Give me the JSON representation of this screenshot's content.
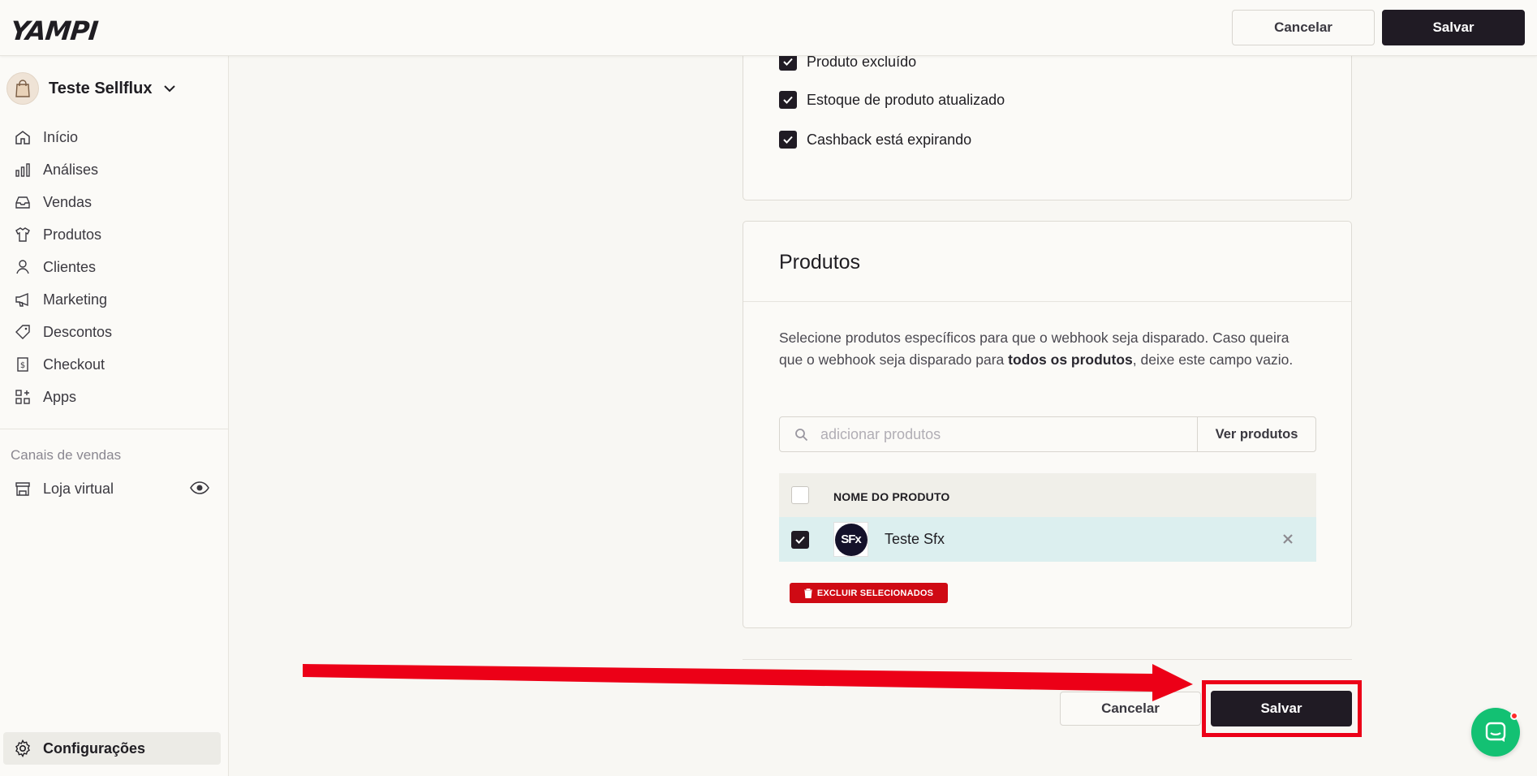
{
  "app": {
    "logo_text": "YAMPI"
  },
  "header": {
    "cancel_label": "Cancelar",
    "save_label": "Salvar"
  },
  "sidebar": {
    "store_name": "Teste Sellflux",
    "items": [
      {
        "label": "Início",
        "icon": "home-icon"
      },
      {
        "label": "Análises",
        "icon": "bar-chart-icon"
      },
      {
        "label": "Vendas",
        "icon": "inbox-icon"
      },
      {
        "label": "Produtos",
        "icon": "shirt-icon"
      },
      {
        "label": "Clientes",
        "icon": "user-icon"
      },
      {
        "label": "Marketing",
        "icon": "megaphone-icon"
      },
      {
        "label": "Descontos",
        "icon": "tag-icon"
      },
      {
        "label": "Checkout",
        "icon": "receipt-icon"
      },
      {
        "label": "Apps",
        "icon": "apps-icon"
      }
    ],
    "sales_channels_label": "Canais de vendas",
    "loja_label": "Loja virtual",
    "settings_label": "Configurações"
  },
  "events": {
    "items": [
      {
        "label": "Produto excluído",
        "checked": true
      },
      {
        "label": "Estoque de produto atualizado",
        "checked": true
      },
      {
        "label": "Cashback está expirando",
        "checked": true
      }
    ]
  },
  "products": {
    "title": "Produtos",
    "desc_part1": "Selecione produtos específicos para que o webhook seja disparado. Caso queira que o webhook seja disparado para ",
    "desc_bold": "todos os produtos",
    "desc_part2": ", deixe este campo vazio.",
    "search_placeholder": "adicionar produtos",
    "view_button": "Ver produtos",
    "column_header": "NOME DO PRODUTO",
    "rows": [
      {
        "name": "Teste Sfx",
        "logo_text": "SFx",
        "checked": true
      }
    ],
    "delete_selected_label": "EXCLUIR SELECIONADOS"
  },
  "footer": {
    "cancel_label": "Cancelar",
    "save_label": "Salvar"
  },
  "colors": {
    "primary_dark": "#201b24",
    "danger": "#cf0a14",
    "annotation_red": "#ec0017",
    "chat_green": "#13c173",
    "selected_row": "#dcefef"
  }
}
